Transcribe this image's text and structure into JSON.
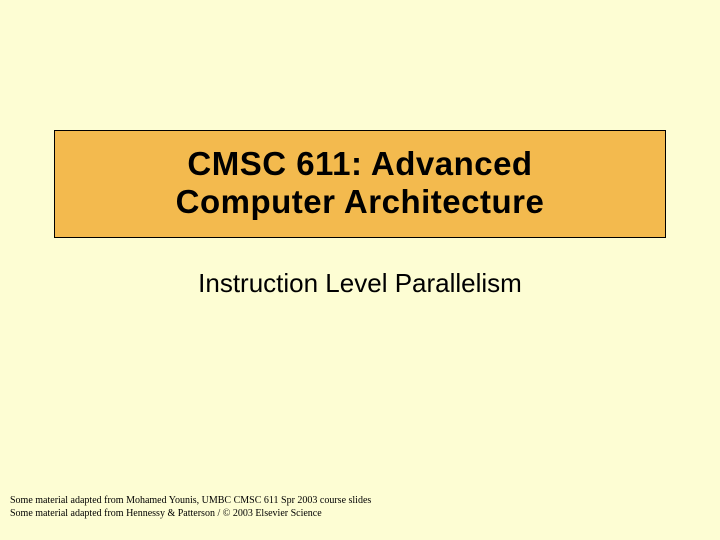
{
  "title": {
    "line1": "CMSC 611: Advanced",
    "line2": "Computer Architecture"
  },
  "subtitle": "Instruction Level Parallelism",
  "footer": {
    "line1": "Some material adapted from Mohamed Younis, UMBC CMSC 611 Spr 2003 course slides",
    "line2": "Some material adapted from Hennessy & Patterson / © 2003 Elsevier Science"
  }
}
